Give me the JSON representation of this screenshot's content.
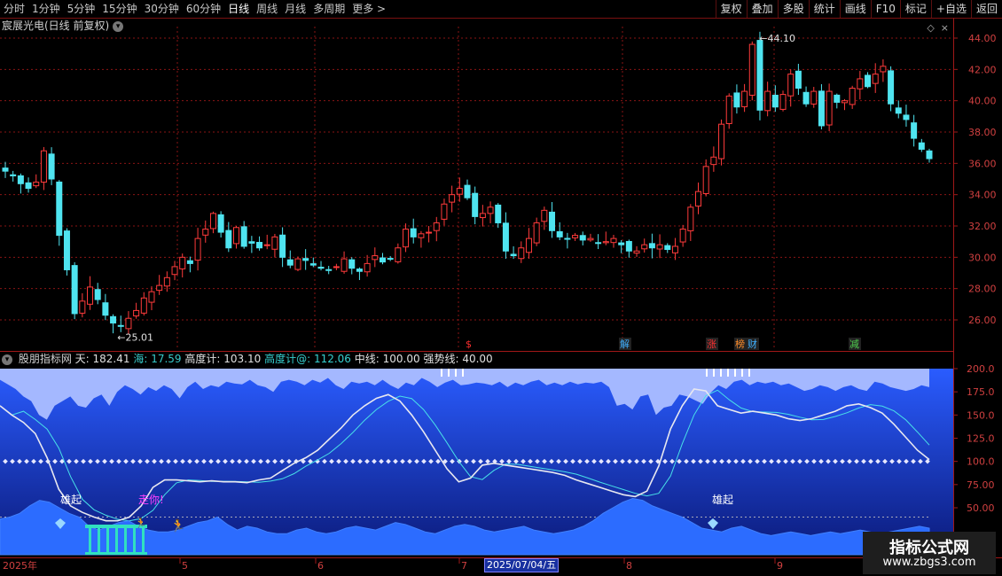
{
  "toolbar": {
    "periods": [
      "分时",
      "1分钟",
      "5分钟",
      "15分钟",
      "30分钟",
      "60分钟",
      "日线",
      "周线",
      "月线",
      "多周期",
      "更多 >"
    ],
    "active_period": "日线",
    "tools": [
      "复权",
      "叠加",
      "多股",
      "统计",
      "画线",
      "F10",
      "标记",
      "+自选",
      "返回"
    ]
  },
  "chart_title": "宸展光电(日线 前复权)",
  "price_axis": [
    "44.00",
    "42.00",
    "40.00",
    "38.00",
    "36.00",
    "34.00",
    "32.00",
    "30.00",
    "28.00",
    "26.00"
  ],
  "annotations": {
    "high_label": "44.10",
    "low_label": "25.01"
  },
  "markers": {
    "dollar": "$",
    "jie": "解",
    "zhang": "涨",
    "bang": "榜",
    "cai": "财",
    "jian": "减"
  },
  "indicator": {
    "name": "股朋指标网",
    "tian": "天: 182.41",
    "hai": "海: 17.59",
    "gdj": "高度计: 103.10",
    "gdj2": "高度计@: 112.06",
    "zx": "中线: 100.00",
    "qsx": "强势线: 40.00",
    "axis": [
      "200.0",
      "175.0",
      "150.0",
      "125.0",
      "100.0",
      "75.00",
      "50.00"
    ],
    "label_xq1": "雄起",
    "label_zn": "走你!",
    "label_xq2": "雄起"
  },
  "date_axis": {
    "year": "2025年",
    "months": [
      "5",
      "6",
      "7",
      "8",
      "9"
    ],
    "highlight": "2025/07/04/五"
  },
  "watermark": {
    "line1": "指标公式网",
    "line2": "www.zbgs3.com"
  },
  "colors": {
    "up": "#ff3b3b",
    "down": "#4fe4f0",
    "grid": "#8a1414",
    "indicator_fill": "#1a3cff",
    "indicator_mountain": "#a4b8ff"
  }
}
